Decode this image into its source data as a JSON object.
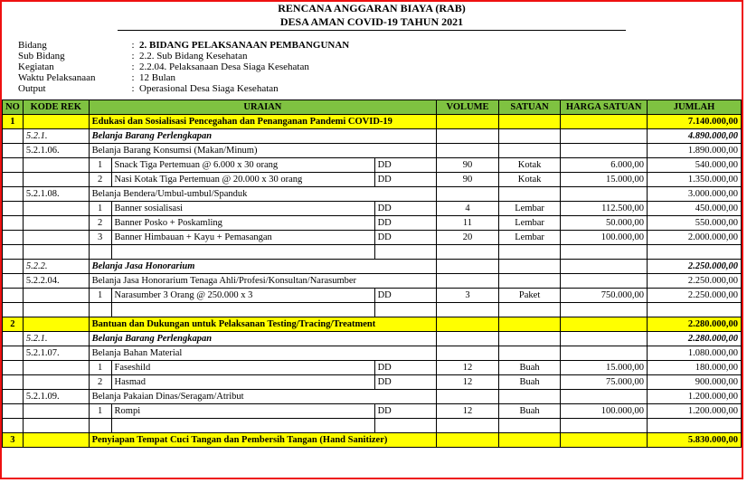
{
  "titles": {
    "line1": "RENCANA ANGGARAN BIAYA (RAB)",
    "line2": "DESA AMAN COVID-19 TAHUN 2021"
  },
  "meta": {
    "bidang_label": "Bidang",
    "bidang_value": "2. BIDANG PELAKSANAAN PEMBANGUNAN",
    "subbidang_label": "Sub Bidang",
    "subbidang_value": "2.2. Sub Bidang Kesehatan",
    "kegiatan_label": "Kegiatan",
    "kegiatan_value": "2.2.04. Pelaksanaan Desa Siaga Kesehatan",
    "waktu_label": "Waktu Pelaksanaan",
    "waktu_value": "12 Bulan",
    "output_label": "Output",
    "output_value": "Operasional Desa Siaga Kesehatan"
  },
  "headers": {
    "no": "NO",
    "rek": "KODE REK",
    "uraian": "URAIAN",
    "volume": "VOLUME",
    "satuan": "SATUAN",
    "harga": "HARGA SATUAN",
    "jumlah": "JUMLAH"
  },
  "sections": [
    {
      "no": "1",
      "title": "Edukasi dan Sosialisasi Pencegahan dan Penanganan Pandemi COVID-19",
      "total": "7.140.000,00",
      "groups": [
        {
          "rek": "5.2.1.",
          "label": "Belanja Barang Perlengkapan",
          "subtotal": "4.890.000,00",
          "subs": [
            {
              "rek": "5.2.1.06.",
              "label": "Belanja Barang Konsumsi (Makan/Minum)",
              "subtotal": "1.890.000,00",
              "items": [
                {
                  "idx": "1",
                  "uraian": "Snack  Tiga Pertemuan @ 6.000 x 30 orang",
                  "src": "DD",
                  "vol": "90",
                  "sat": "Kotak",
                  "harga": "6.000,00",
                  "jml": "540.000,00"
                },
                {
                  "idx": "2",
                  "uraian": "Nasi Kotak Tiga Pertemuan @ 20.000 x 30 orang",
                  "src": "DD",
                  "vol": "90",
                  "sat": "Kotak",
                  "harga": "15.000,00",
                  "jml": "1.350.000,00"
                }
              ]
            },
            {
              "rek": "5.2.1.08.",
              "label": "Belanja Bendera/Umbul-umbul/Spanduk",
              "subtotal": "3.000.000,00",
              "items": [
                {
                  "idx": "1",
                  "uraian": "Banner  sosialisasi",
                  "src": "DD",
                  "vol": "4",
                  "sat": "Lembar",
                  "harga": "112.500,00",
                  "jml": "450.000,00"
                },
                {
                  "idx": "2",
                  "uraian": "Banner Posko + Poskamling",
                  "src": "DD",
                  "vol": "11",
                  "sat": "Lembar",
                  "harga": "50.000,00",
                  "jml": "550.000,00"
                },
                {
                  "idx": "3",
                  "uraian": "Banner Himbauan + Kayu + Pemasangan",
                  "src": "DD",
                  "vol": "20",
                  "sat": "Lembar",
                  "harga": "100.000,00",
                  "jml": "2.000.000,00"
                }
              ]
            }
          ]
        },
        {
          "rek": "5.2.2.",
          "label": "Belanja Jasa Honorarium",
          "subtotal": "2.250.000,00",
          "subs": [
            {
              "rek": "5.2.2.04.",
              "label": "Belanja Jasa Honorarium Tenaga Ahli/Profesi/Konsultan/Narasumber",
              "subtotal": "2.250.000,00",
              "items": [
                {
                  "idx": "1",
                  "uraian": "Narasumber 3 Orang @ 250.000 x 3",
                  "src": "DD",
                  "vol": "3",
                  "sat": "Paket",
                  "harga": "750.000,00",
                  "jml": "2.250.000,00"
                }
              ]
            }
          ]
        }
      ]
    },
    {
      "no": "2",
      "title": "Bantuan dan Dukungan untuk Pelaksanan Testing/Tracing/Treatment",
      "total": "2.280.000,00",
      "groups": [
        {
          "rek": "5.2.1.",
          "label": "Belanja Barang Perlengkapan",
          "subtotal": "2.280.000,00",
          "subs": [
            {
              "rek": "5.2.1.07.",
              "label": "Belanja Bahan Material",
              "subtotal": "1.080.000,00",
              "items": [
                {
                  "idx": "1",
                  "uraian": "Faseshild",
                  "src": "DD",
                  "vol": "12",
                  "sat": "Buah",
                  "harga": "15.000,00",
                  "jml": "180.000,00"
                },
                {
                  "idx": "2",
                  "uraian": "Hasmad",
                  "src": "DD",
                  "vol": "12",
                  "sat": "Buah",
                  "harga": "75.000,00",
                  "jml": "900.000,00"
                }
              ]
            },
            {
              "rek": "5.2.1.09.",
              "label": "Belanja Pakaian Dinas/Seragam/Atribut",
              "subtotal": "1.200.000,00",
              "items": [
                {
                  "idx": "1",
                  "uraian": "Rompi",
                  "src": "DD",
                  "vol": "12",
                  "sat": "Buah",
                  "harga": "100.000,00",
                  "jml": "1.200.000,00"
                }
              ]
            }
          ]
        }
      ]
    },
    {
      "no": "3",
      "title": "Penyiapan Tempat Cuci Tangan dan Pembersih Tangan (Hand Sanitizer)",
      "total": "5.830.000,00",
      "groups": []
    }
  ]
}
